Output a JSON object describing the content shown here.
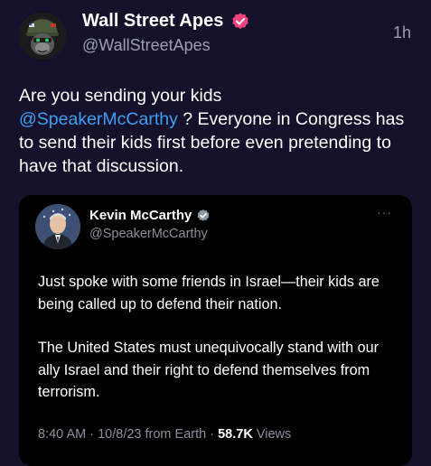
{
  "post": {
    "author": {
      "display_name": "Wall Street Apes",
      "handle": "@WallStreetApes",
      "avatar_icon": "ape-soldier-avatar",
      "verified_icon": "verified-badge-icon",
      "verified_color": "#f0427d"
    },
    "timestamp": "1h",
    "text": {
      "line_start": "Are you sending your kids",
      "mention": "@SpeakerMcCarthy",
      "rest": " ? Everyone in Congress has to send their kids first before even pretending to have that discussion."
    },
    "accent_color": "#3aa0f2",
    "background_color": "#15112a"
  },
  "quote": {
    "author": {
      "display_name": "Kevin McCarthy",
      "handle": "@SpeakerMcCarthy",
      "avatar_icon": "portrait-avatar",
      "verified_icon": "gray-verified-badge-icon",
      "verified_color": "#8b98a5"
    },
    "more_icon": "more-options-icon",
    "more_label": "···",
    "paragraphs": [
      "Just spoke with some friends in Israel—their kids are being called up to defend their nation.",
      "The United States must unequivocally stand with our ally Israel and their right to defend themselves from terrorism."
    ],
    "meta": {
      "time": "8:40 AM",
      "separator": " · ",
      "date": "10/8/23",
      "source": "from Earth",
      "views_count": "58.7K",
      "views_label": "Views"
    },
    "background_color": "#000000"
  }
}
